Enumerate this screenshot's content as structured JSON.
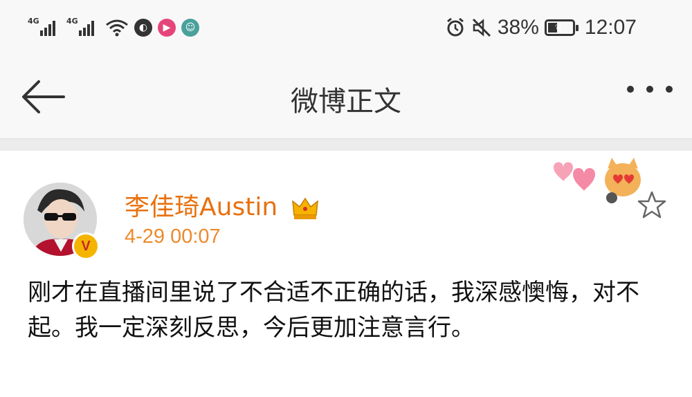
{
  "status_bar": {
    "network1": "4G",
    "network2": "4G",
    "battery_percent": "38%",
    "battery_level": 0.38,
    "time": "12:07",
    "icons": [
      "signal-icon",
      "signal-icon",
      "wifi-icon",
      "app-icon",
      "video-app-icon",
      "android-icon",
      "alarm-icon",
      "mute-icon",
      "battery-icon"
    ]
  },
  "nav": {
    "title": "微博正文",
    "back_icon": "arrow-left-icon",
    "more_icon": "more-dots-icon"
  },
  "post": {
    "username": "李佳琦Austin",
    "badge_icon": "crown-icon",
    "verified_mark": "V",
    "time": "4-29 00:07",
    "content": "刚才在直播间里说了不合适不正确的话，我深感懊悔，对不起。我一定深刻反思，今后更加注意言行。",
    "favorite_icon": "star-icon",
    "decoration_icon": "cat-hearts-sticker-icon"
  },
  "colors": {
    "username": "#e8700e",
    "time": "#ec8a2c",
    "background": "#f8f8f8"
  }
}
